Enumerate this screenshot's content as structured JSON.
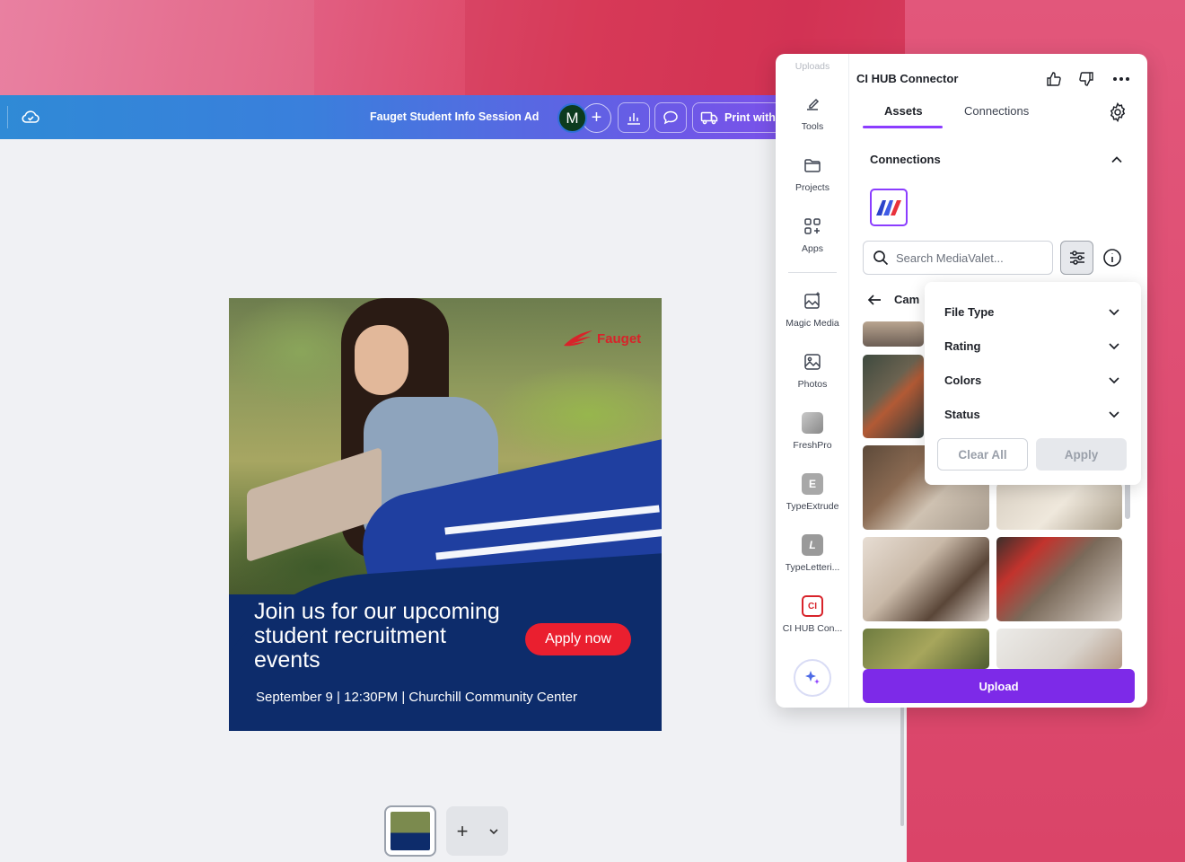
{
  "topbar": {
    "doc_title": "Fauget Student Info Session Ad",
    "avatar_initial": "M",
    "add_collaborator": "+",
    "print_label": "Print with"
  },
  "design": {
    "brand": "Fauget",
    "headline": "Join us for our upcoming student recruitment events",
    "cta": "Apply now",
    "event_line": "September 9 | 12:30PM | Churchill Community Center"
  },
  "pages": {
    "add_label": "+"
  },
  "rail": {
    "uploads_label": "Uploads",
    "items": [
      {
        "label": "Tools",
        "icon": "tools-icon"
      },
      {
        "label": "Projects",
        "icon": "folder-icon"
      },
      {
        "label": "Apps",
        "icon": "apps-icon"
      },
      {
        "label": "Magic Media",
        "icon": "magic-media-icon"
      },
      {
        "label": "Photos",
        "icon": "photos-icon"
      },
      {
        "label": "FreshPro",
        "icon": "freshpro-icon"
      },
      {
        "label": "TypeExtrude",
        "icon": "typeextrude-icon"
      },
      {
        "label": "TypeLetteri...",
        "icon": "typelettering-icon"
      },
      {
        "label": "CI HUB Con...",
        "icon": "cihub-icon"
      }
    ],
    "app_glyphs": {
      "typeextrude": "E",
      "typelettering": "L",
      "cihub": "CI"
    }
  },
  "panel": {
    "title": "CI HUB Connector",
    "tabs": [
      {
        "label": "Assets",
        "active": true
      },
      {
        "label": "Connections",
        "active": false
      }
    ],
    "section_title": "Connections",
    "search_placeholder": "Search MediaValet...",
    "breadcrumb": "Cam",
    "upload_label": "Upload"
  },
  "filter_popover": {
    "rows": [
      "File Type",
      "Rating",
      "Colors",
      "Status"
    ],
    "clear_label": "Clear All",
    "apply_label": "Apply"
  },
  "colors": {
    "accent": "#7d2ae8",
    "brand_red": "#ea1f2f",
    "design_navy": "#0d2c6b"
  }
}
